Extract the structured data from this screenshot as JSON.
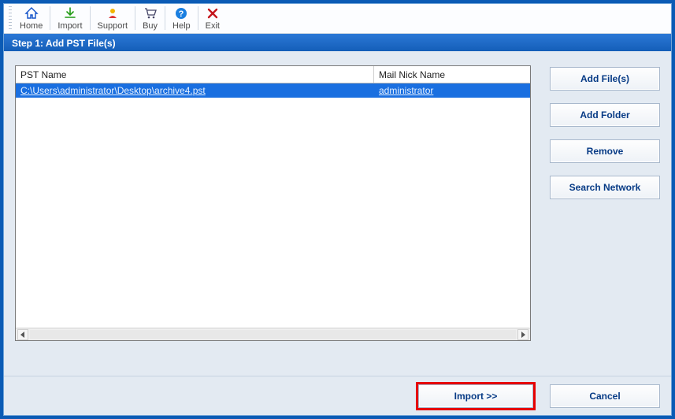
{
  "toolbar": {
    "items": [
      {
        "label": "Home"
      },
      {
        "label": "Import"
      },
      {
        "label": "Support"
      },
      {
        "label": "Buy"
      },
      {
        "label": "Help"
      },
      {
        "label": "Exit"
      }
    ]
  },
  "step_header": "Step 1: Add PST File(s)",
  "table": {
    "columns": {
      "pst_name": "PST Name",
      "mail_nick_name": "Mail Nick Name"
    },
    "rows": [
      {
        "pst_name": "C:\\Users\\administrator\\Desktop\\archive4.pst",
        "mail_nick_name": "administrator",
        "selected": true
      }
    ]
  },
  "side_buttons": {
    "add_files": "Add File(s)",
    "add_folder": "Add Folder",
    "remove": "Remove",
    "search_network": "Search Network"
  },
  "footer": {
    "import": "Import >>",
    "cancel": "Cancel"
  }
}
